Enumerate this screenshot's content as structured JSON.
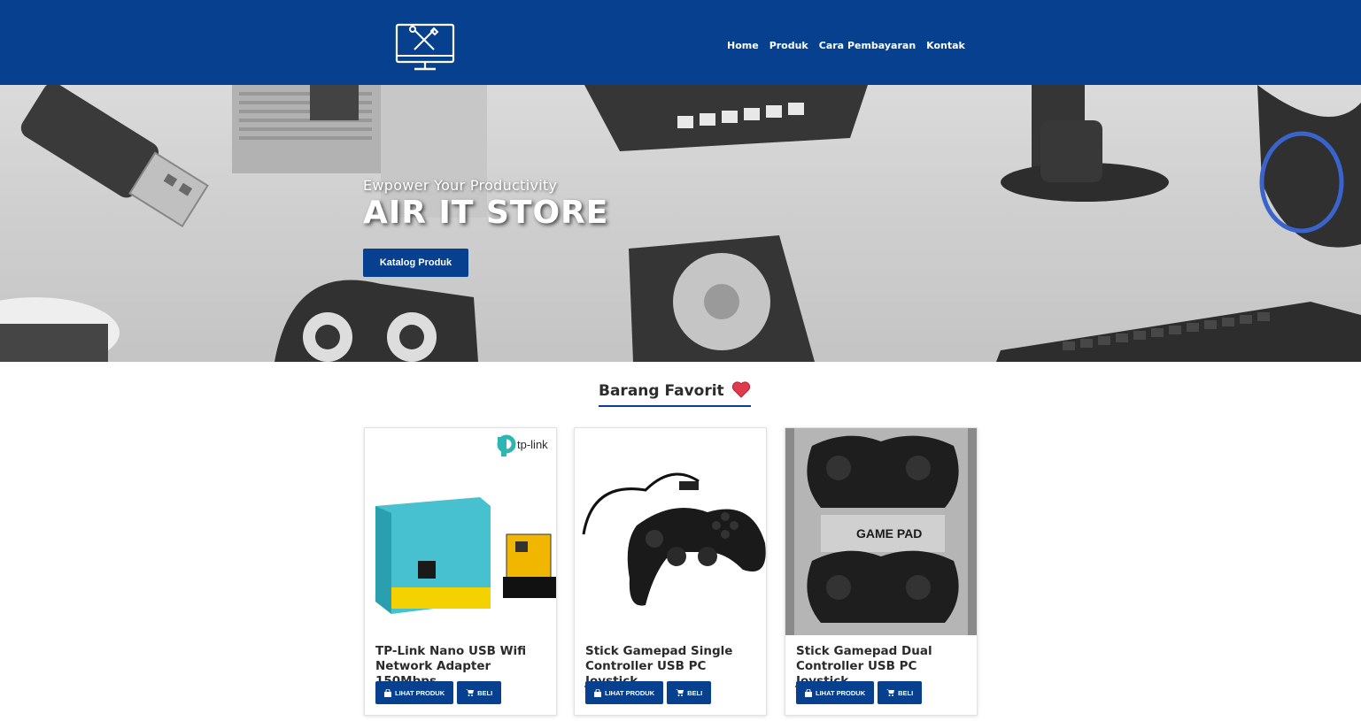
{
  "nav": {
    "items": [
      {
        "label": "Home"
      },
      {
        "label": "Produk"
      },
      {
        "label": "Cara Pembayaran"
      },
      {
        "label": "Kontak"
      }
    ]
  },
  "hero": {
    "tagline": "Ewpower Your Productivity",
    "title": "AIR IT STORE",
    "button_label": "Katalog Produk"
  },
  "favorites": {
    "title": "Barang Favorit",
    "products": [
      {
        "name": "TP-Link Nano USB Wifi Network Adapter 150Mbps",
        "view_label": "LIHAT PRODUK",
        "buy_label": "BELI",
        "brand_text": "tp-link"
      },
      {
        "name": "Stick Gamepad Single Controller USB PC Joystick",
        "view_label": "LIHAT PRODUK",
        "buy_label": "BELI"
      },
      {
        "name": "Stick Gamepad Dual Controller USB PC Joystick",
        "view_label": "LIHAT PRODUK",
        "buy_label": "BELI",
        "package_text": "GAME PAD"
      }
    ]
  },
  "colors": {
    "primary": "#06408f",
    "heart": "#e03a4e"
  }
}
